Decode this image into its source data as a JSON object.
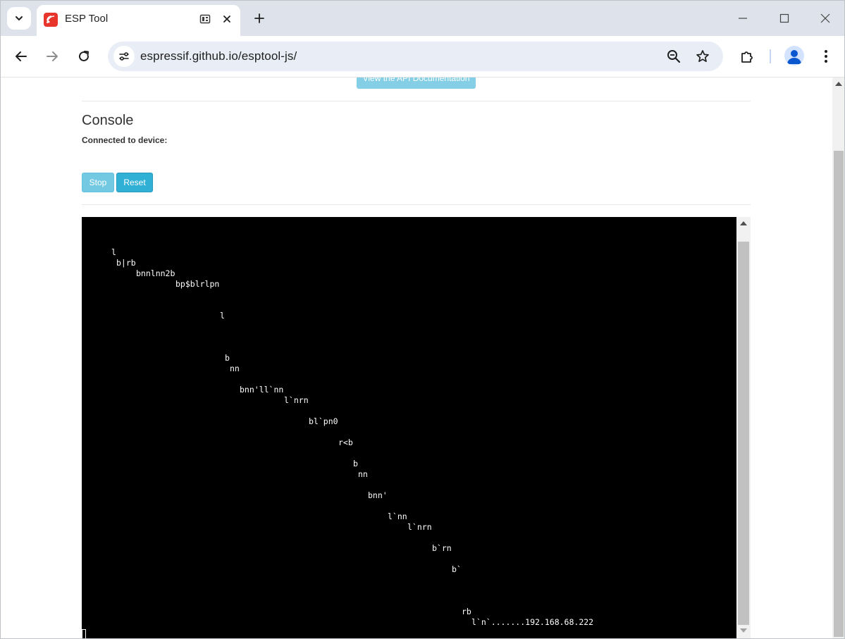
{
  "browser": {
    "tab_title": "ESP Tool",
    "url": "espressif.github.io/esptool-js/",
    "icons": {
      "tab_search": "chevron-down-icon",
      "favicon": "espressif-logo-icon",
      "tab_media": "media-icon",
      "tab_close": "close-icon",
      "new_tab": "plus-icon",
      "back": "arrow-left-icon",
      "forward": "arrow-right-icon",
      "reload": "reload-icon",
      "site_info": "tune-icon",
      "zoom": "zoom-out-icon",
      "bookmark": "star-icon",
      "extensions": "puzzle-icon",
      "profile": "person-icon",
      "menu": "kebab-menu-icon"
    }
  },
  "page": {
    "api_doc_button": "View the API Documentation",
    "console_title": "Console",
    "connected_label": "Connected to device:",
    "stop_button": "Stop",
    "reset_button": "Reset"
  },
  "terminal": {
    "lines": [
      "l",
      "b|rb",
      "bnnlnn2b",
      "bp$blrlpn",
      "l",
      "b",
      "nn",
      "bnn'll`nn",
      "l`nrn",
      "bl`pn0",
      "r<b",
      "b",
      "nn",
      "bnn'",
      "l`nn",
      "l`nrn",
      "b`rn",
      "b`",
      "rb",
      "l`n`.......192.168.68.222"
    ]
  },
  "colors": {
    "accent_info": "#5bc0de",
    "tab_strip": "#dee3eb",
    "omnibox": "#e9eef6",
    "terminal_bg": "#000000"
  }
}
